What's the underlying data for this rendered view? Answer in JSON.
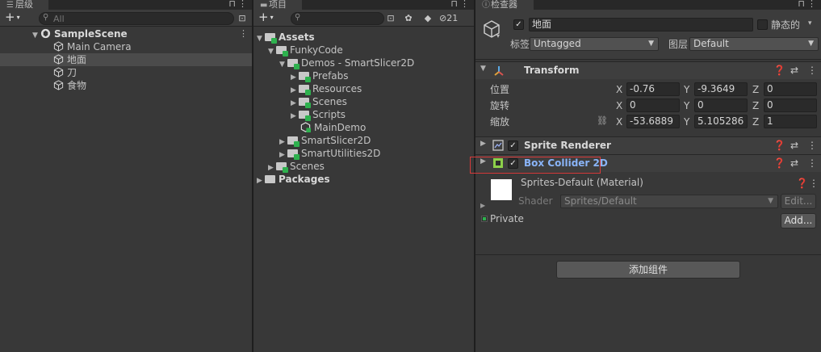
{
  "hierarchy": {
    "tab_label": "层级",
    "search_placeholder": "All",
    "scene": {
      "name": "SampleScene"
    },
    "items": [
      {
        "label": "Main Camera"
      },
      {
        "label": "地面"
      },
      {
        "label": "刀"
      },
      {
        "label": "食物"
      }
    ]
  },
  "project": {
    "tab_label": "项目",
    "hidden_count": "21",
    "tree": [
      {
        "label": "Assets"
      },
      {
        "label": "FunkyCode"
      },
      {
        "label": "Demos - SmartSlicer2D"
      },
      {
        "label": "Prefabs"
      },
      {
        "label": "Resources"
      },
      {
        "label": "Scenes"
      },
      {
        "label": "Scripts"
      },
      {
        "label": "MainDemo"
      },
      {
        "label": "SmartSlicer2D"
      },
      {
        "label": "SmartUtilities2D"
      },
      {
        "label": "Scenes"
      },
      {
        "label": "Packages"
      }
    ]
  },
  "inspector": {
    "tab_label": "检查器",
    "object_name": "地面",
    "static_label": "静态的",
    "tag_label": "标签",
    "tag_value": "Untagged",
    "layer_label": "图层",
    "layer_value": "Default",
    "transform": {
      "title": "Transform",
      "position_label": "位置",
      "rotation_label": "旋转",
      "scale_label": "缩放",
      "position": {
        "x": "-0.76",
        "y": "-9.3649",
        "z": "0"
      },
      "rotation": {
        "x": "0",
        "y": "0",
        "z": "0"
      },
      "scale": {
        "x": "-53.6889",
        "y": "5.105286",
        "z": "1"
      },
      "axis_x": "X",
      "axis_y": "Y",
      "axis_z": "Z"
    },
    "sprite_renderer": {
      "title": "Sprite Renderer"
    },
    "box_collider": {
      "title": "Box Collider 2D"
    },
    "material": {
      "name": "Sprites-Default (Material)",
      "shader_label": "Shader",
      "shader_value": "Sprites/Default",
      "edit_button": "Edit...",
      "private_label": "Private",
      "add_button": "Add..."
    },
    "add_component_button": "添加组件"
  },
  "colors": {
    "highlight_box": "#d83a3a",
    "collider_title": "#8ab4f8",
    "asset_badge": "#2eb14e"
  }
}
